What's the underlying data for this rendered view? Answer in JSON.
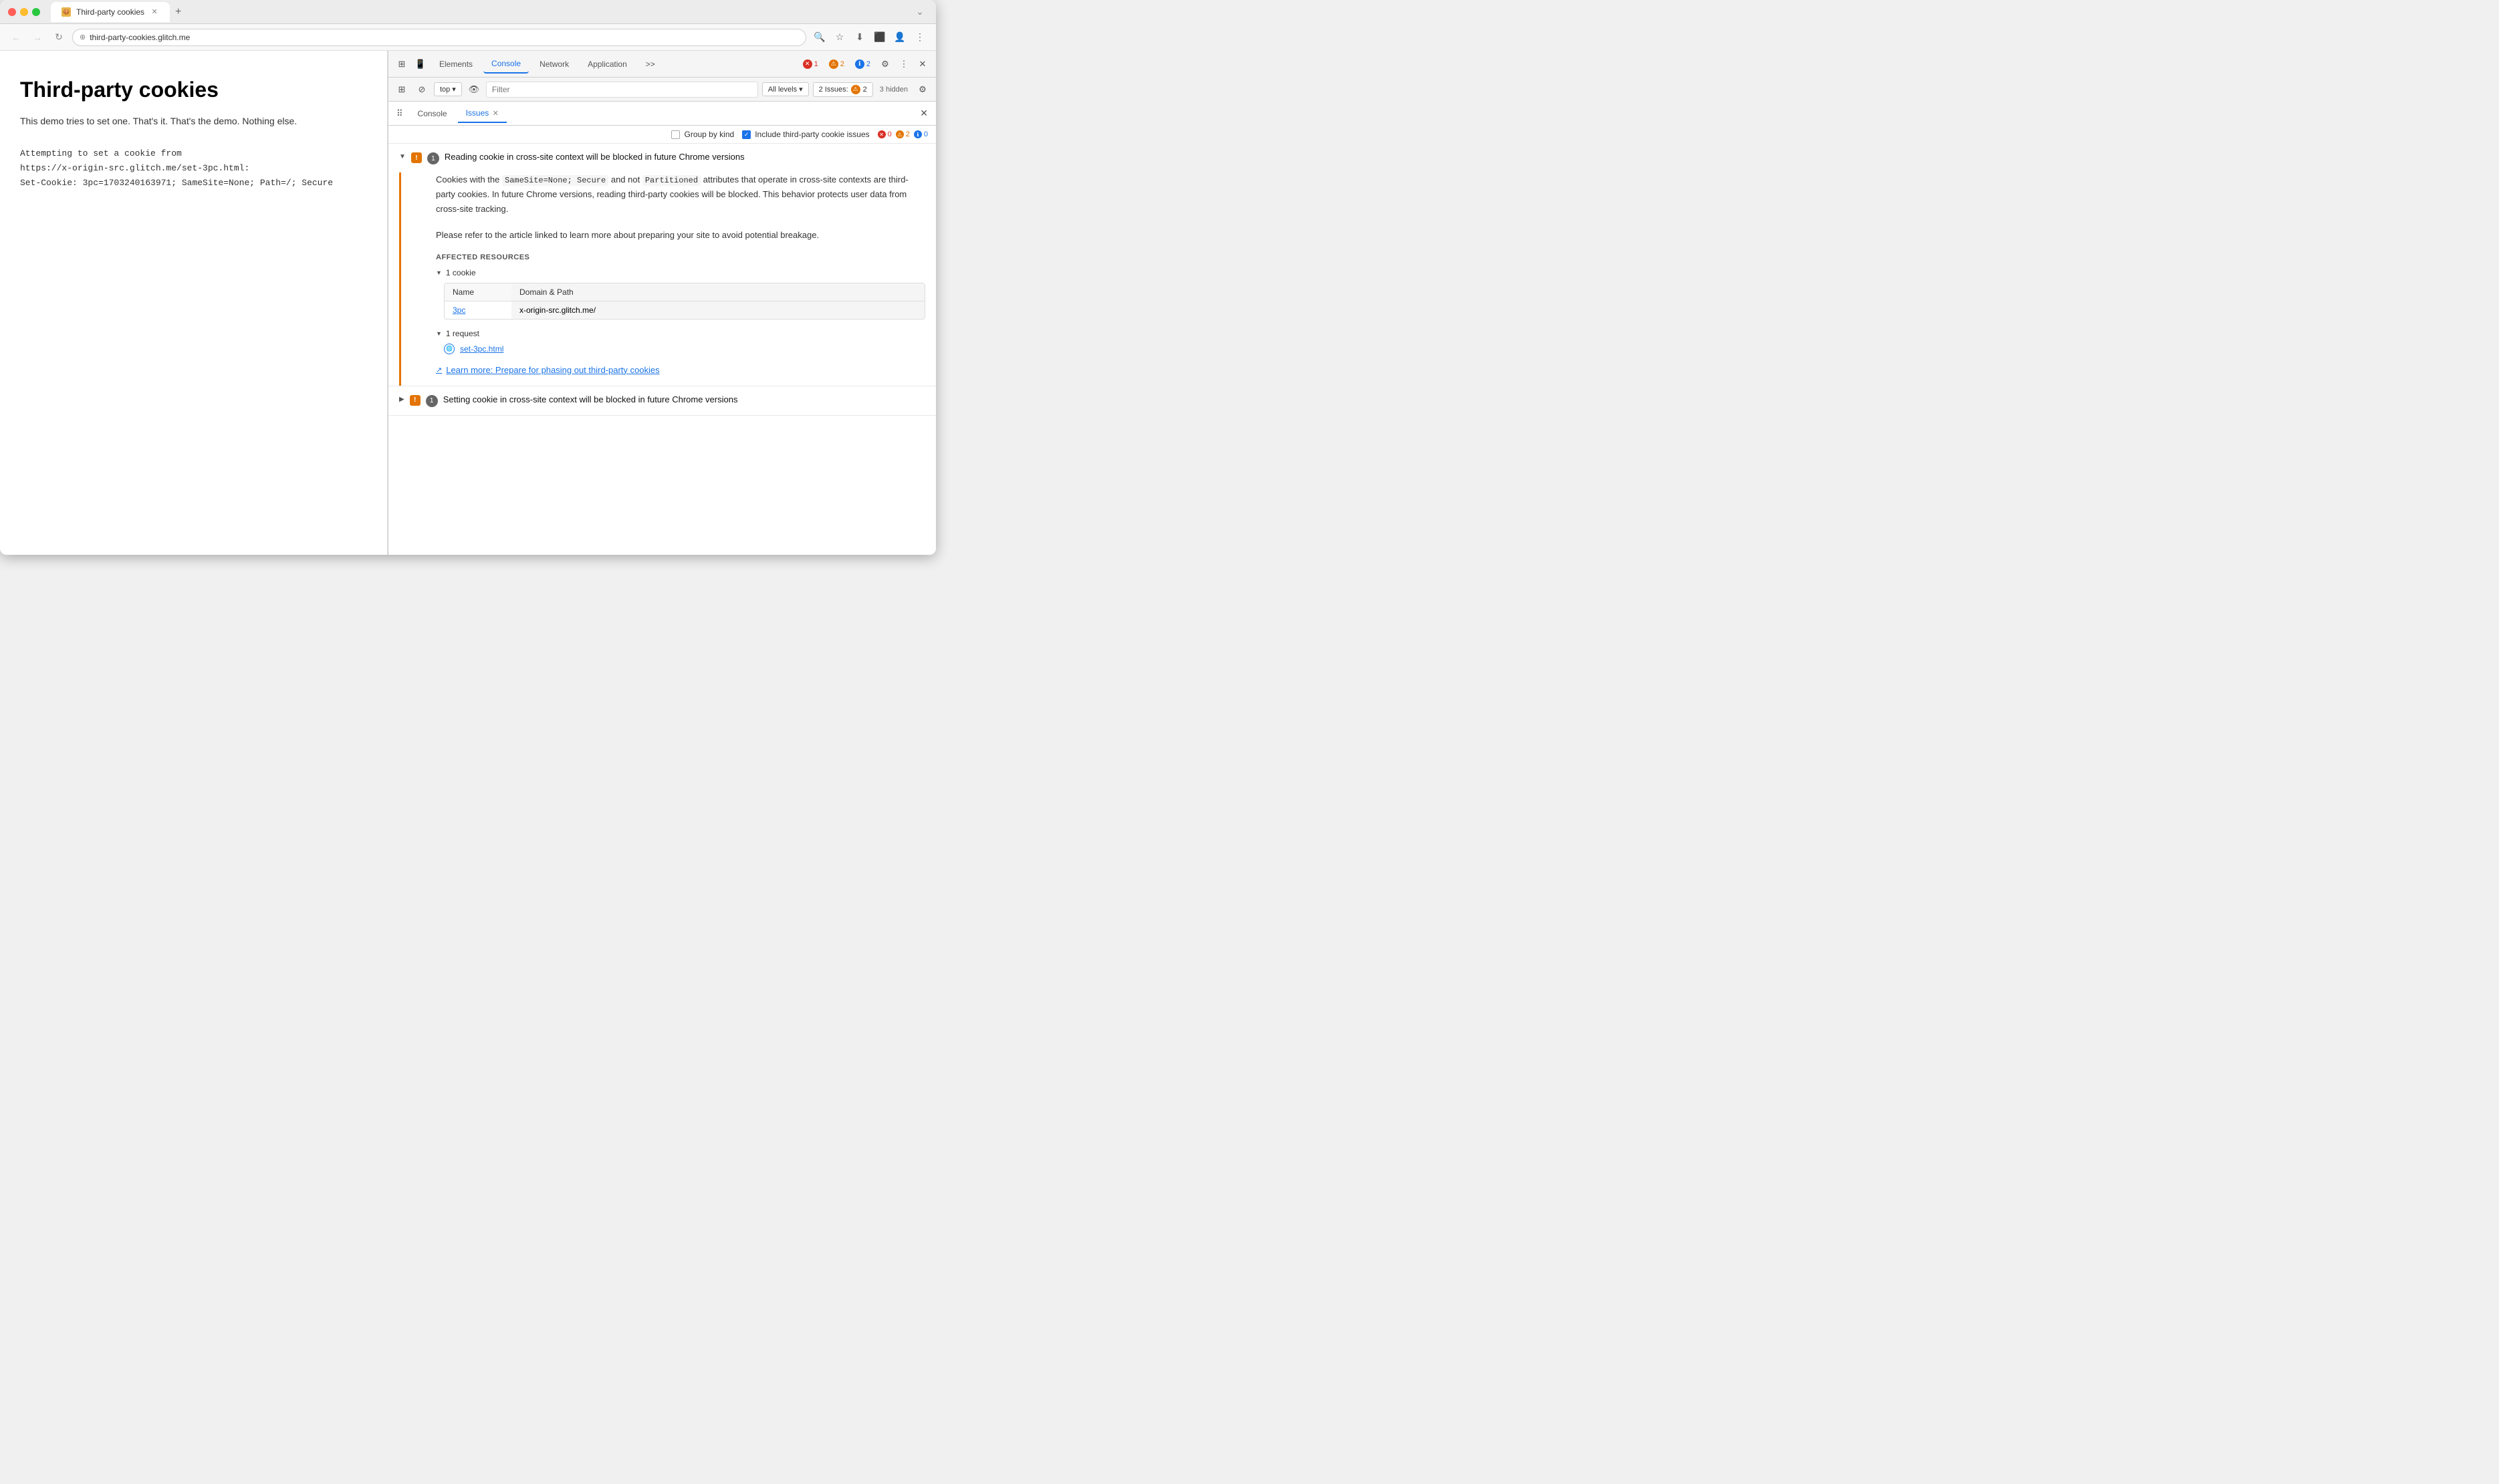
{
  "browser": {
    "tab_title": "Third-party cookies",
    "tab_favicon": "🍪",
    "url": "third-party-cookies.glitch.me",
    "new_tab_btn": "+"
  },
  "toolbar": {
    "back_label": "←",
    "forward_label": "→",
    "reload_label": "↻",
    "address_icon": "⊕",
    "search_icon": "🔍",
    "bookmark_icon": "☆",
    "download_icon": "⬇",
    "extensions_icon": "⬛",
    "profile_icon": "👤",
    "menu_icon": "⋮",
    "minimize_icon": "—",
    "expand_icon": "⌄"
  },
  "page": {
    "title": "Third-party cookies",
    "description": "This demo tries to set one. That's it. That's the demo. Nothing else.",
    "cookie_attempt_label": "Attempting to set a cookie from",
    "cookie_url": "https://x-origin-src.glitch.me/set-3pc.html:",
    "cookie_header": "Set-Cookie: 3pc=1703240163971; SameSite=None; Path=/; Secure"
  },
  "devtools": {
    "tabs": [
      {
        "label": "Elements",
        "active": false
      },
      {
        "label": "Console",
        "active": false
      },
      {
        "label": "Network",
        "active": false
      },
      {
        "label": "Application",
        "active": false
      }
    ],
    "overflow_btn": ">>",
    "error_count": "1",
    "warn_count": "2",
    "info_count": "2",
    "settings_icon": "⚙",
    "more_icon": "⋮",
    "close_icon": "✕",
    "bar2": {
      "sidebar_icon": "▣",
      "block_icon": "⊘",
      "context_selector": "top",
      "eye_icon": "👁",
      "filter_placeholder": "Filter",
      "levels_label": "All levels",
      "issues_label": "2 Issues:",
      "issues_warn": "2",
      "hidden_label": "3 hidden",
      "settings_icon": "⚙"
    }
  },
  "issues_panel": {
    "hamburger": "⠿",
    "tabs": [
      {
        "label": "Console",
        "active": false
      },
      {
        "label": "Issues",
        "active": true
      }
    ],
    "close_icon": "✕",
    "options": {
      "group_by_kind_label": "Group by kind",
      "include_third_party_label": "Include third-party cookie issues",
      "include_checked": true,
      "error_count": "0",
      "warn_count": "2",
      "info_count": "0"
    },
    "issues": [
      {
        "id": "issue-1",
        "expanded": true,
        "icon_type": "warn",
        "count": "1",
        "title": "Reading cookie in cross-site context will be blocked in future Chrome versions",
        "description_parts": [
          "Cookies with the ",
          "SameSite=None; Secure",
          " and not ",
          "Partitioned",
          " attributes that operate in cross-site contexts are third-party cookies. In future Chrome versions, reading third-party cookies will be blocked. This behavior protects user data from cross-site tracking."
        ],
        "description_2": "Please refer to the article linked to learn more about preparing your site to avoid potential breakage.",
        "affected_resources_label": "AFFECTED RESOURCES",
        "cookie_section": {
          "count_label": "1 cookie",
          "col_name": "Name",
          "col_domain": "Domain & Path",
          "cookie_name": "3pc",
          "cookie_domain": "x-origin-src.glitch.me/"
        },
        "request_section": {
          "count_label": "1 request",
          "request_name": "set-3pc.html"
        },
        "learn_more_label": "Learn more: Prepare for phasing out third-party cookies"
      },
      {
        "id": "issue-2",
        "expanded": false,
        "icon_type": "warn",
        "count": "1",
        "title": "Setting cookie in cross-site context will be blocked in future Chrome versions"
      }
    ]
  }
}
